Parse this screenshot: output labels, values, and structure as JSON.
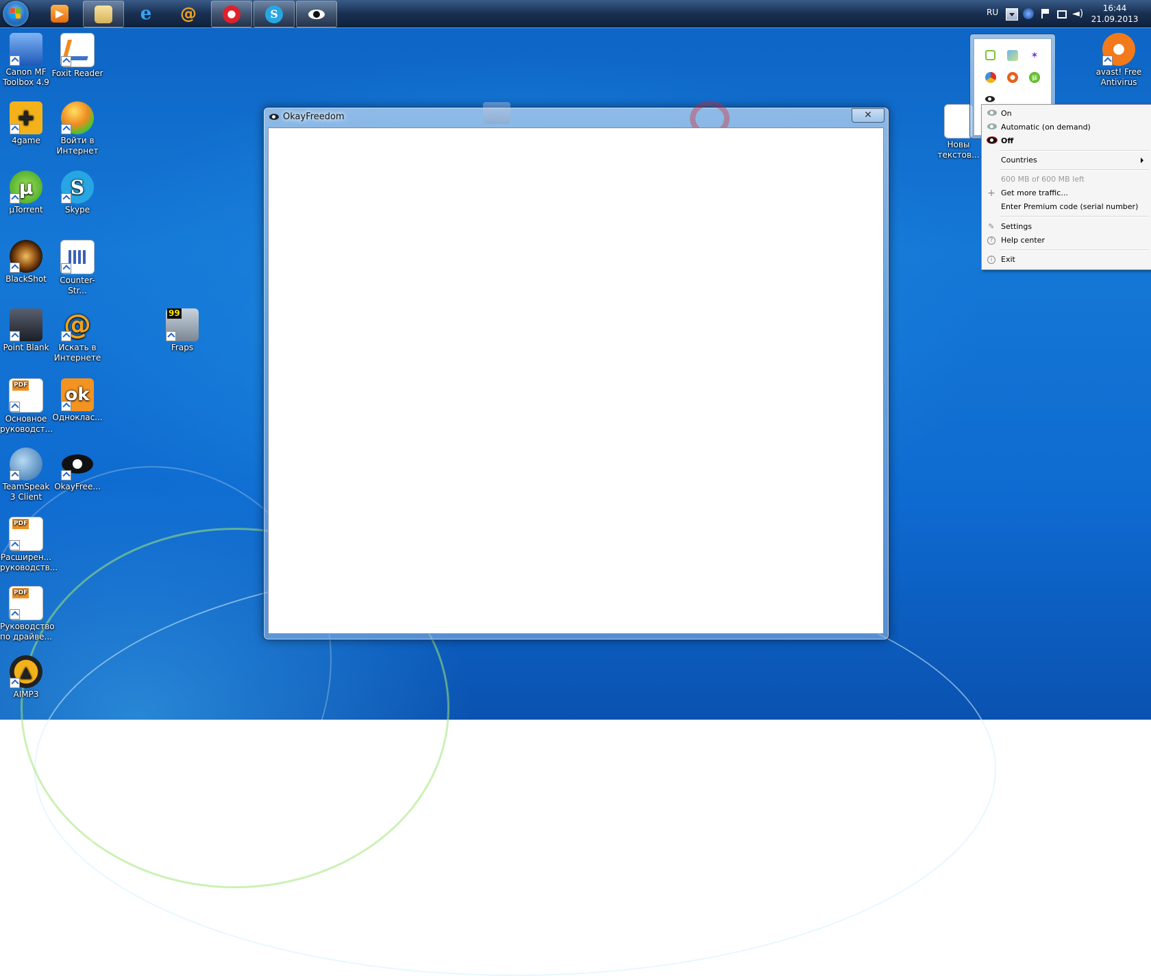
{
  "taskbar": {
    "language": "RU",
    "clock_time": "16:44",
    "clock_date": "21.09.2013"
  },
  "desktop_icons": [
    {
      "label": "Canon MF Toolbox 4.9"
    },
    {
      "label": "Foxit Reader"
    },
    {
      "label": "4game"
    },
    {
      "label": "Войти в Интернет"
    },
    {
      "label": "µTorrent"
    },
    {
      "label": "Skype"
    },
    {
      "label": "BlackShot"
    },
    {
      "label": "Counter-Str..."
    },
    {
      "label": "Point Blank"
    },
    {
      "label": "Искать в Интернете"
    },
    {
      "label": "Fraps"
    },
    {
      "label": "Основное руководст..."
    },
    {
      "label": "Одноклас..."
    },
    {
      "label": "TeamSpeak 3 Client"
    },
    {
      "label": "OkayFree..."
    },
    {
      "label": "Расширен... руководств..."
    },
    {
      "label": "Руководство по драйве..."
    },
    {
      "label": "AIMP3"
    },
    {
      "label": "avast! Free Antivirus"
    },
    {
      "label": "Новы текстов..."
    }
  ],
  "window": {
    "title": "OkayFreedom",
    "close": "✕"
  },
  "menu": {
    "on": "On",
    "automatic": "Automatic (on demand)",
    "off": "Off",
    "countries": "Countries",
    "traffic_left": "600 MB of 600 MB left",
    "get_more": "Get more traffic...",
    "premium": "Enter Premium code (serial number)",
    "settings": "Settings",
    "help": "Help center",
    "exit": "Exit"
  },
  "icons": {
    "fraps_badge": "99",
    "pdf_badge": "PDF"
  },
  "colors": {
    "taskbar": "#1c3458",
    "desktop": "#1578d6",
    "menu_bg": "#f5f5f5",
    "disabled_text": "#9a9a9a"
  }
}
